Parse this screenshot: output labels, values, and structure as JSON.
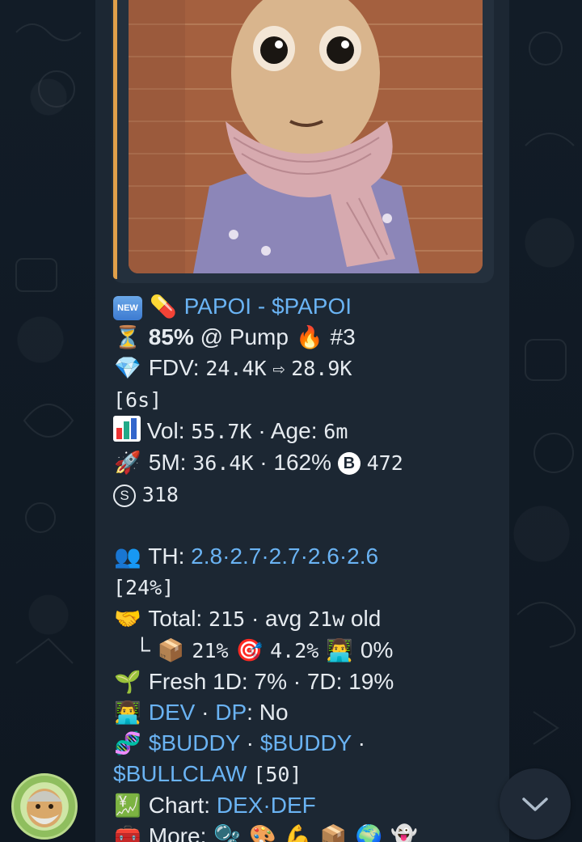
{
  "message": {
    "title": "PAPOI - $PAPOI",
    "new_badge": "NEW",
    "line_pump": {
      "pct": "85%",
      "text": "@ Pump",
      "rank": "#3"
    },
    "line_fdv": {
      "label": "FDV:",
      "from": "24.4K",
      "arrow": "⇨",
      "to": "28.9K"
    },
    "line_fdv_age": "[6s]",
    "line_vol": {
      "label": "Vol:",
      "value": "55.7K",
      "sep": "·",
      "age_label": "Age:",
      "age": "6m"
    },
    "line_5m": {
      "label": "5M:",
      "value": "36.4K",
      "pct": "162%",
      "b_letter": "B",
      "b_value": "472"
    },
    "line_s": {
      "s_letter": "S",
      "value": "318"
    },
    "line_th": {
      "label": "TH:",
      "values": "2.8·2.7·2.7·2.6·2.6"
    },
    "line_th_pct": "[24%]",
    "line_total": {
      "label": "Total:",
      "value": "215",
      "avg_label": "avg",
      "avg_value": "21w",
      "suffix": "old"
    },
    "line_sub": {
      "prefix": "└",
      "box_pct": "21%",
      "target_pct": "4.2%",
      "dev_pct": "0%"
    },
    "line_fresh": {
      "label": "Fresh 1D:",
      "d1": "7%",
      "d7_label": "7D:",
      "d7": "19%"
    },
    "line_dev": {
      "dev": "DEV",
      "dp": "DP",
      "dp_value": "No"
    },
    "line_buddy": {
      "t1": "$BUDDY",
      "t2": "$BUDDY",
      "t3": "$BULLCLAW",
      "count": "[50]"
    },
    "line_chart": {
      "label": "Chart:",
      "dex": "DEX",
      "def": "DEF"
    },
    "line_more": {
      "label": "More:"
    }
  },
  "colors": {
    "link": "#6ab3f3",
    "bubble": "#1c2733",
    "background": "#0e1621",
    "accent": "#e0a04a"
  },
  "icons": [
    "new-badge-icon",
    "pill-icon",
    "hourglass-icon",
    "fire-icon",
    "diamond-icon",
    "bar-chart-icon",
    "rocket-icon",
    "people-icon",
    "handshake-icon",
    "box-icon",
    "target-icon",
    "technologist-icon",
    "seedling-icon",
    "dna-icon",
    "chart-yen-icon",
    "toolbox-icon",
    "bubbles-icon",
    "palette-icon",
    "muscle-icon",
    "globe-icon",
    "ghost-icon",
    "chevron-down-icon"
  ]
}
